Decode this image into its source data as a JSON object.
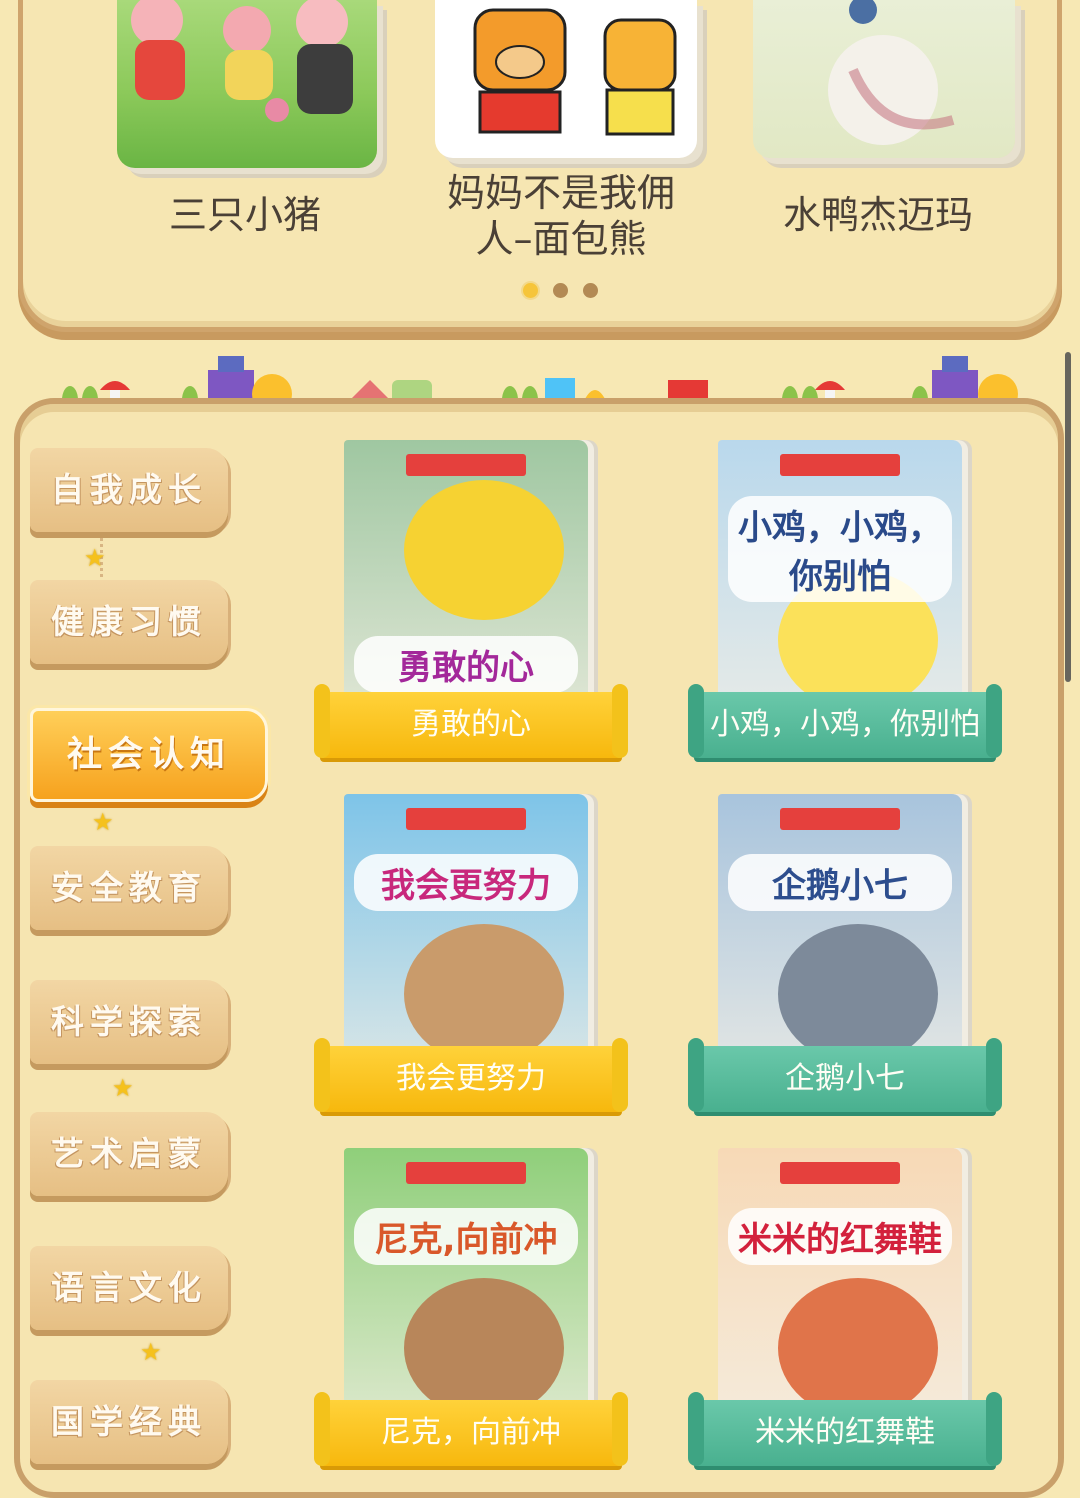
{
  "carousel": {
    "books": [
      {
        "title": "三只小猪"
      },
      {
        "title": "妈妈不是我佣\n人–面包熊"
      },
      {
        "title": "水鸭杰迈玛"
      }
    ],
    "dots": 3,
    "active_dot": 0
  },
  "categories": [
    {
      "label": "自我成长"
    },
    {
      "label": "健康习惯"
    },
    {
      "label": "社会认知"
    },
    {
      "label": "安全教育"
    },
    {
      "label": "科学探索"
    },
    {
      "label": "艺术启蒙"
    },
    {
      "label": "语言文化"
    },
    {
      "label": "国学经典"
    }
  ],
  "active_category": "社会认知",
  "books": [
    {
      "cover_title": "勇敢的心",
      "label": "勇敢的心",
      "ribbon": "yellow",
      "cover_color": "#9fc7a1",
      "title_color": "#a3289a"
    },
    {
      "cover_title": "小鸡，小鸡，\n你别怕",
      "label": "小鸡，小鸡，你别怕",
      "ribbon": "green",
      "cover_color": "#b9d8ec",
      "title_color": "#2a4a8a"
    },
    {
      "cover_title": "我会更努力",
      "label": "我会更努力",
      "ribbon": "yellow",
      "cover_color": "#7ec4e8",
      "title_color": "#c8287c"
    },
    {
      "cover_title": "企鹅小七",
      "label": "企鹅小七",
      "ribbon": "green",
      "cover_color": "#a8c4dd",
      "title_color": "#2d4e8e"
    },
    {
      "cover_title": "尼克,向前冲",
      "label": "尼克，向前冲",
      "ribbon": "yellow",
      "cover_color": "#8fcf7a",
      "title_color": "#d9582a"
    },
    {
      "cover_title": "米米的红舞鞋",
      "label": "米米的红舞鞋",
      "ribbon": "green",
      "cover_color": "#f7d9b6",
      "title_color": "#d3213c"
    }
  ]
}
